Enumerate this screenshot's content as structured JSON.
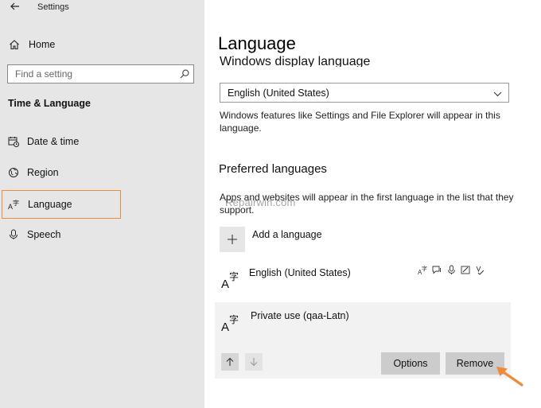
{
  "window": {
    "title": "Settings"
  },
  "sidebar": {
    "back_icon": "back-arrow-icon",
    "home_label": "Home",
    "search": {
      "placeholder": "Find a setting"
    },
    "section_title": "Time & Language",
    "items": [
      {
        "label": "Date & time",
        "icon": "calendar-clock-icon"
      },
      {
        "label": "Region",
        "icon": "globe-icon"
      },
      {
        "label": "Language",
        "icon": "language-icon",
        "active": true
      },
      {
        "label": "Speech",
        "icon": "microphone-icon"
      }
    ]
  },
  "main": {
    "title": "Language",
    "display_language": {
      "heading": "Windows display language",
      "selected": "English (United States)",
      "description": "Windows features like Settings and File Explorer will appear in this language."
    },
    "preferred": {
      "heading": "Preferred languages",
      "description": "Apps and websites will appear in the first language in the list that they support.",
      "watermark": "Repairwin.com",
      "add_label": "Add a language",
      "languages": [
        {
          "name": "English (United States)"
        },
        {
          "name": "Private use (qaa-Latn)",
          "selected": true
        }
      ],
      "options_label": "Options",
      "remove_label": "Remove"
    }
  },
  "colors": {
    "sidebar_bg": "#e6e6e6",
    "highlight": "#f08a35",
    "button_bg": "#cccccc",
    "selected_row_bg": "#f2f2f2"
  }
}
